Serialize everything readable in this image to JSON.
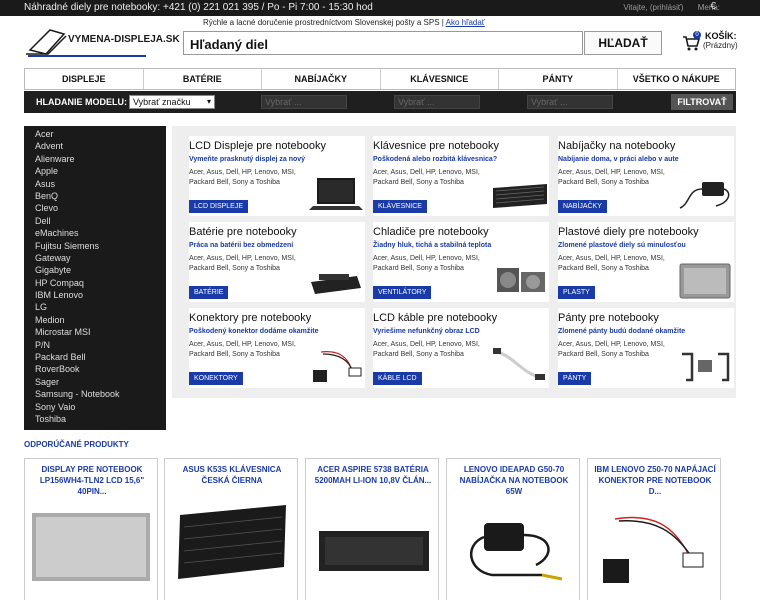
{
  "topbar": {
    "info": "Náhradné diely pre notebooky: +421 (0) 221 021 395 / Po - Pi 7:00 - 15:30 hod",
    "welcome": "Vitajte, (prihlásiť)",
    "currency": "Mena:",
    "currency_symbol": "€"
  },
  "header": {
    "logo_text": "VYMENA-DISPLEJA.SK",
    "tagline": "Rýchle a lacné doručenie prostredníctvom Slovenskej pošty a SPS | ",
    "tagline_link": "Ako hľadať",
    "search_placeholder": "Hľadaný diel",
    "search_button": "HĽADAŤ",
    "cart_count": "0",
    "cart_label": "KOŠÍK:",
    "cart_status": "(Prázdny)"
  },
  "nav": [
    "DISPLEJE",
    "BATÉRIE",
    "NABÍJAČKY",
    "KLÁVESNICE",
    "PÁNTY",
    "VŠETKO O NÁKUPE"
  ],
  "modelbar": {
    "label": "HLADANIE MODELU:",
    "brand_select": "Vybrať značku",
    "select2": "Vybrať ...",
    "select3": "Vybrať ...",
    "select4": "Vybrať ...",
    "filter_button": "FILTROVAŤ"
  },
  "sidebar": [
    "Acer",
    "Advent",
    "Alienware",
    "Apple",
    "Asus",
    "BenQ",
    "Clevo",
    "Dell",
    "eMachines",
    "Fujitsu Siemens",
    "Gateway",
    "Gigabyte",
    "HP Compaq",
    "IBM Lenovo",
    "LG",
    "Medion",
    "Microstar MSI",
    "P/N",
    "Packard Bell",
    "RoverBook",
    "Sager",
    "Samsung - Notebook",
    "Sony Vaio",
    "Toshiba"
  ],
  "categories": [
    {
      "title": "LCD Displeje pre notebooky",
      "subtitle": "Vymeňte prasknutý displej za nový",
      "desc": "Acer, Asus, Dell, HP, Lenovo, MSI, Packard Bell, Sony a Toshiba",
      "button": "LCD DISPLEJE",
      "icon": "laptop-icon"
    },
    {
      "title": "Klávesnice pre notebooky",
      "subtitle": "Poškodená alebo rozbitá klávesnica?",
      "desc": "Acer, Asus, Dell, HP, Lenovo, MSI, Packard Bell, Sony a Toshiba",
      "button": "KLÁVESNICE",
      "icon": "keyboard-icon"
    },
    {
      "title": "Nabíjačky na notebooky",
      "subtitle": "Nabíjanie doma, v práci alebo v aute",
      "desc": "Acer, Asus, Dell, HP, Lenovo, MSI, Packard Bell, Sony a Toshiba",
      "button": "NABÍJAČKY",
      "icon": "charger-icon"
    },
    {
      "title": "Batérie pre notebooky",
      "subtitle": "Práca na batérii bez obmedzení",
      "desc": "Acer, Asus, Dell, HP, Lenovo, MSI, Packard Bell, Sony a Toshiba",
      "button": "BATÉRIE",
      "icon": "battery-icon"
    },
    {
      "title": "Chladiče pre notebooky",
      "subtitle": "Žiadny hluk, tichá a stabilná teplota",
      "desc": "Acer, Asus, Dell, HP, Lenovo, MSI, Packard Bell, Sony a Toshiba",
      "button": "VENTILÁTORY",
      "icon": "fan-icon"
    },
    {
      "title": "Plastové diely pre notebooky",
      "subtitle": "Zlomené plastové diely sú minulosťou",
      "desc": "Acer, Asus, Dell, HP, Lenovo, MSI, Packard Bell, Sony a Toshiba",
      "button": "PLASTY",
      "icon": "laptop-cover-icon"
    },
    {
      "title": "Konektory pre notebooky",
      "subtitle": "Poškodený konektor dodáme okamžite",
      "desc": "Acer, Asus, Dell, HP, Lenovo, MSI, Packard Bell, Sony a Toshiba",
      "button": "KONEKTORY",
      "icon": "connector-icon"
    },
    {
      "title": "LCD káble pre notebooky",
      "subtitle": "Vyriešime nefunkčný obraz LCD",
      "desc": "Acer, Asus, Dell, HP, Lenovo, MSI, Packard Bell, Sony a Toshiba",
      "button": "KÁBLE LCD",
      "icon": "cable-icon"
    },
    {
      "title": "Pánty pre notebooky",
      "subtitle": "Zlomené pánty budú dodané okamžite",
      "desc": "Acer, Asus, Dell, HP, Lenovo, MSI, Packard Bell, Sony a Toshiba",
      "button": "PÁNTY",
      "icon": "hinge-icon"
    }
  ],
  "recommended": {
    "title": "ODPORÚČANÉ PRODUKTY",
    "products": [
      {
        "name": "DISPLAY PRE NOTEBOOK LP156WH4-TLN2 LCD 15,6\" 40PIN...",
        "icon": "lcd-panel-icon"
      },
      {
        "name": "ASUS K53S KLÁVESNICA ČESKÁ ČIERNA",
        "icon": "keyboard-icon"
      },
      {
        "name": "ACER ASPIRE 5738 BATÉRIA 5200MAH LI-ION 10,8V ČLÁN...",
        "icon": "battery-icon"
      },
      {
        "name": "LENOVO IDEAPAD G50-70 NABÍJAČKA NA NOTEBOOK 65W",
        "icon": "charger-icon"
      },
      {
        "name": "IBM LENOVO Z50-70 NAPÁJACÍ KONEKTOR PRE NOTEBOOK D...",
        "icon": "connector-icon"
      }
    ]
  }
}
